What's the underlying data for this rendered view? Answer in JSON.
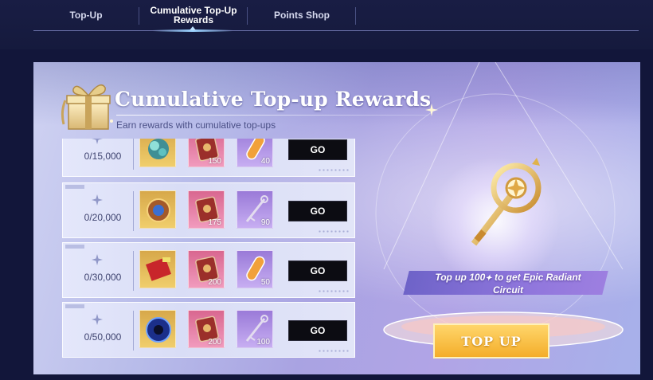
{
  "tabs": [
    {
      "label_line1": "Top-Up",
      "label_line2": ""
    },
    {
      "label_line1": "Cumulative Top-Up",
      "label_line2": "Rewards"
    },
    {
      "label_line1": "Points Shop",
      "label_line2": ""
    }
  ],
  "active_tab_index": 1,
  "header": {
    "title": "Cumulative Top-up Rewards",
    "subtitle": "Earn rewards with cumulative top-ups"
  },
  "rewards": [
    {
      "progress": "0/15,000",
      "items": [
        {
          "icon": "teal-crystal-cluster-icon",
          "count": ""
        },
        {
          "icon": "red-card-pack-icon",
          "count": "150"
        },
        {
          "icon": "orange-potion-icon",
          "count": "40"
        }
      ],
      "button": "GO"
    },
    {
      "progress": "0/20,000",
      "items": [
        {
          "icon": "gold-orb-frame-icon",
          "count": ""
        },
        {
          "icon": "red-card-pack-icon",
          "count": "175"
        },
        {
          "icon": "silver-key-icon",
          "count": "90"
        }
      ],
      "button": "GO"
    },
    {
      "progress": "0/30,000",
      "items": [
        {
          "icon": "red-ticket-icon",
          "count": ""
        },
        {
          "icon": "red-card-pack-icon",
          "count": "200"
        },
        {
          "icon": "orange-potion-icon",
          "count": "50"
        }
      ],
      "button": "GO"
    },
    {
      "progress": "0/50,000",
      "items": [
        {
          "icon": "blue-emblem-icon",
          "count": ""
        },
        {
          "icon": "red-card-pack-icon",
          "count": "200"
        },
        {
          "icon": "silver-key-icon",
          "count": "100"
        }
      ],
      "button": "GO"
    }
  ],
  "promo": {
    "line1": "Top up 100",
    "line1_suffix": " to get Epic Radiant",
    "line2": "Circuit",
    "featured_icon": "golden-radiant-key-icon"
  },
  "topup_button": "TOP UP",
  "colors": {
    "background": "#12163a",
    "go_button": "#0c0c12",
    "topup_button": "#f4ad2a",
    "promo_bar": "#7d6bd2"
  }
}
